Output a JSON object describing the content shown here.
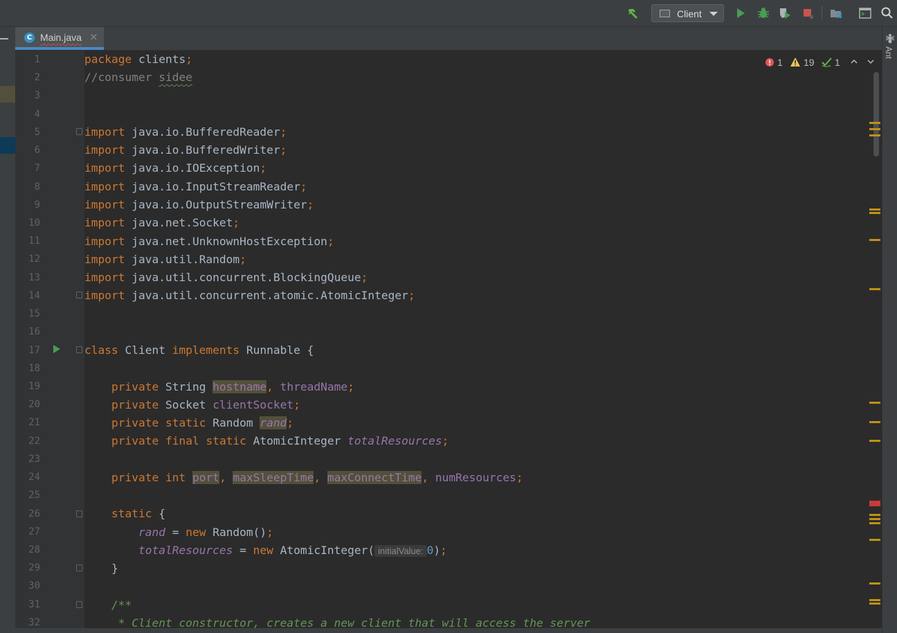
{
  "toolbar": {
    "run_config_label": "Client",
    "icons": [
      "hammer-icon",
      "run-config-icon",
      "run-icon",
      "debug-icon",
      "coverage-icon",
      "stop-icon",
      "project-structure-icon",
      "terminal-icon",
      "search-icon"
    ]
  },
  "tab": {
    "label": "Main.java",
    "icon_letter": "C",
    "close": "×"
  },
  "right_panel": {
    "label": "Ant"
  },
  "inspections": {
    "errors": "1",
    "warnings": "19",
    "typos": "1"
  },
  "hint": {
    "label": "initialValue:"
  },
  "code_lines": [
    {
      "num": "1"
    },
    {
      "num": "2"
    },
    {
      "num": "3"
    },
    {
      "num": "4"
    },
    {
      "num": "5"
    },
    {
      "num": "6"
    },
    {
      "num": "7"
    },
    {
      "num": "8"
    },
    {
      "num": "9"
    },
    {
      "num": "10"
    },
    {
      "num": "11"
    },
    {
      "num": "12"
    },
    {
      "num": "13"
    },
    {
      "num": "14"
    },
    {
      "num": "15"
    },
    {
      "num": "16"
    },
    {
      "num": "17"
    },
    {
      "num": "18"
    },
    {
      "num": "19"
    },
    {
      "num": "20"
    },
    {
      "num": "21"
    },
    {
      "num": "22"
    },
    {
      "num": "23"
    },
    {
      "num": "24"
    },
    {
      "num": "25"
    },
    {
      "num": "26"
    },
    {
      "num": "27"
    },
    {
      "num": "28"
    },
    {
      "num": "29"
    },
    {
      "num": "30"
    },
    {
      "num": "31"
    },
    {
      "num": "32"
    }
  ],
  "code": {
    "l1a": "package",
    "l1b": " clients",
    "l1c": ";",
    "l2a": "//consumer ",
    "l2b": "sidee",
    "imports": [
      "java.io.BufferedReader",
      "java.io.BufferedWriter",
      "java.io.IOException",
      "java.io.InputStreamReader",
      "java.io.OutputStreamWriter",
      "java.net.Socket",
      "java.net.UnknownHostException",
      "java.util.Random",
      "java.util.concurrent.BlockingQueue",
      "java.util.concurrent.atomic.AtomicInteger"
    ],
    "kw_import": "import",
    "semi": ";",
    "kw_class": "class",
    "class_name": " Client ",
    "kw_implements": "implements",
    "class_rest": " Runnable {",
    "kw_private": "private",
    "kw_static": "static",
    "kw_final": "final",
    "kw_int": "int",
    "kw_new": "new",
    "t_string": " String ",
    "f_hostname": "hostname",
    "comma": ", ",
    "f_threadName": "threadName",
    "t_socket": " Socket ",
    "f_clientSocket": "clientSocket",
    "t_random": " Random ",
    "f_rand": "rand",
    "t_atomic": " AtomicInteger ",
    "f_totalResources": "totalResources",
    "f_port": "port",
    "f_maxSleepTime": "maxSleepTime",
    "f_maxConnectTime": "maxConnectTime",
    "f_numResources": "numResources",
    "static_open": " {",
    "eq": " = ",
    "random_ctor": " Random()",
    "atomic_ctor": " AtomicInteger(",
    "zero": "0",
    "close_paren": ")",
    "close_brace": "}",
    "doc_open": "/**",
    "doc_line": " * Client constructor, creates a new client that will access the server"
  },
  "colors": {
    "keyword": "#cc7832",
    "field": "#9876aa",
    "comment": "#808080",
    "doc": "#629755",
    "number": "#6897bb",
    "text": "#a9b7c6",
    "run": "#499c54",
    "warning": "#be9117",
    "error": "#c93b3b",
    "accent": "#4a88c7"
  }
}
